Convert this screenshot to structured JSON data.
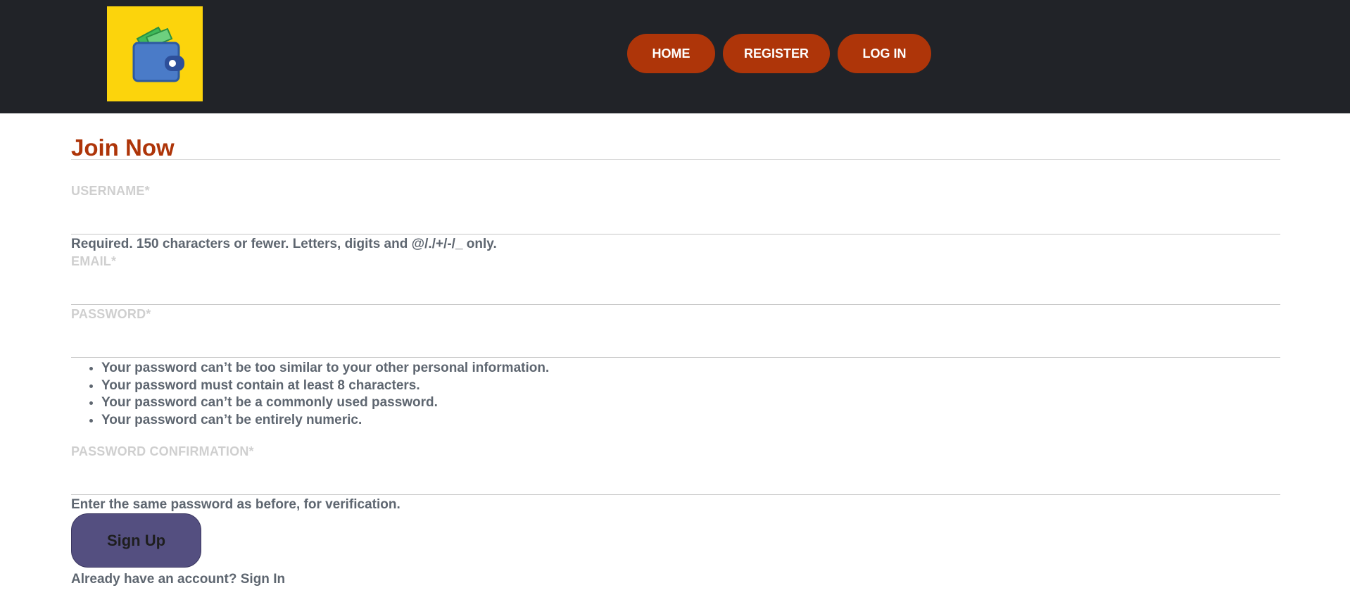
{
  "nav": {
    "logo_icon": "wallet-icon",
    "colors": {
      "background": "#212328",
      "logo_bg": "#fcd40c",
      "button": "#ae3509"
    },
    "links": [
      {
        "label": "HOME"
      },
      {
        "label": "REGISTER"
      },
      {
        "label": "LOG IN"
      }
    ]
  },
  "form": {
    "title": "Join Now",
    "username": {
      "label": "USERNAME*",
      "value": "",
      "help": "Required. 150 characters or fewer. Letters, digits and @/./+/-/_ only."
    },
    "email": {
      "label": "EMAIL*",
      "value": ""
    },
    "password": {
      "label": "PASSWORD*",
      "value": "",
      "rules": [
        "Your password can’t be too similar to your other personal information.",
        "Your password must contain at least 8 characters.",
        "Your password can’t be a commonly used password.",
        "Your password can’t be entirely numeric."
      ]
    },
    "password_confirmation": {
      "label": "PASSWORD CONFIRMATION*",
      "value": "",
      "help": "Enter the same password as before, for verification."
    },
    "submit_label": "Sign Up",
    "signin_prompt": "Already have an account?",
    "signin_link": "Sign In",
    "colors": {
      "title": "#ae3509",
      "submit": "#544f80"
    }
  }
}
